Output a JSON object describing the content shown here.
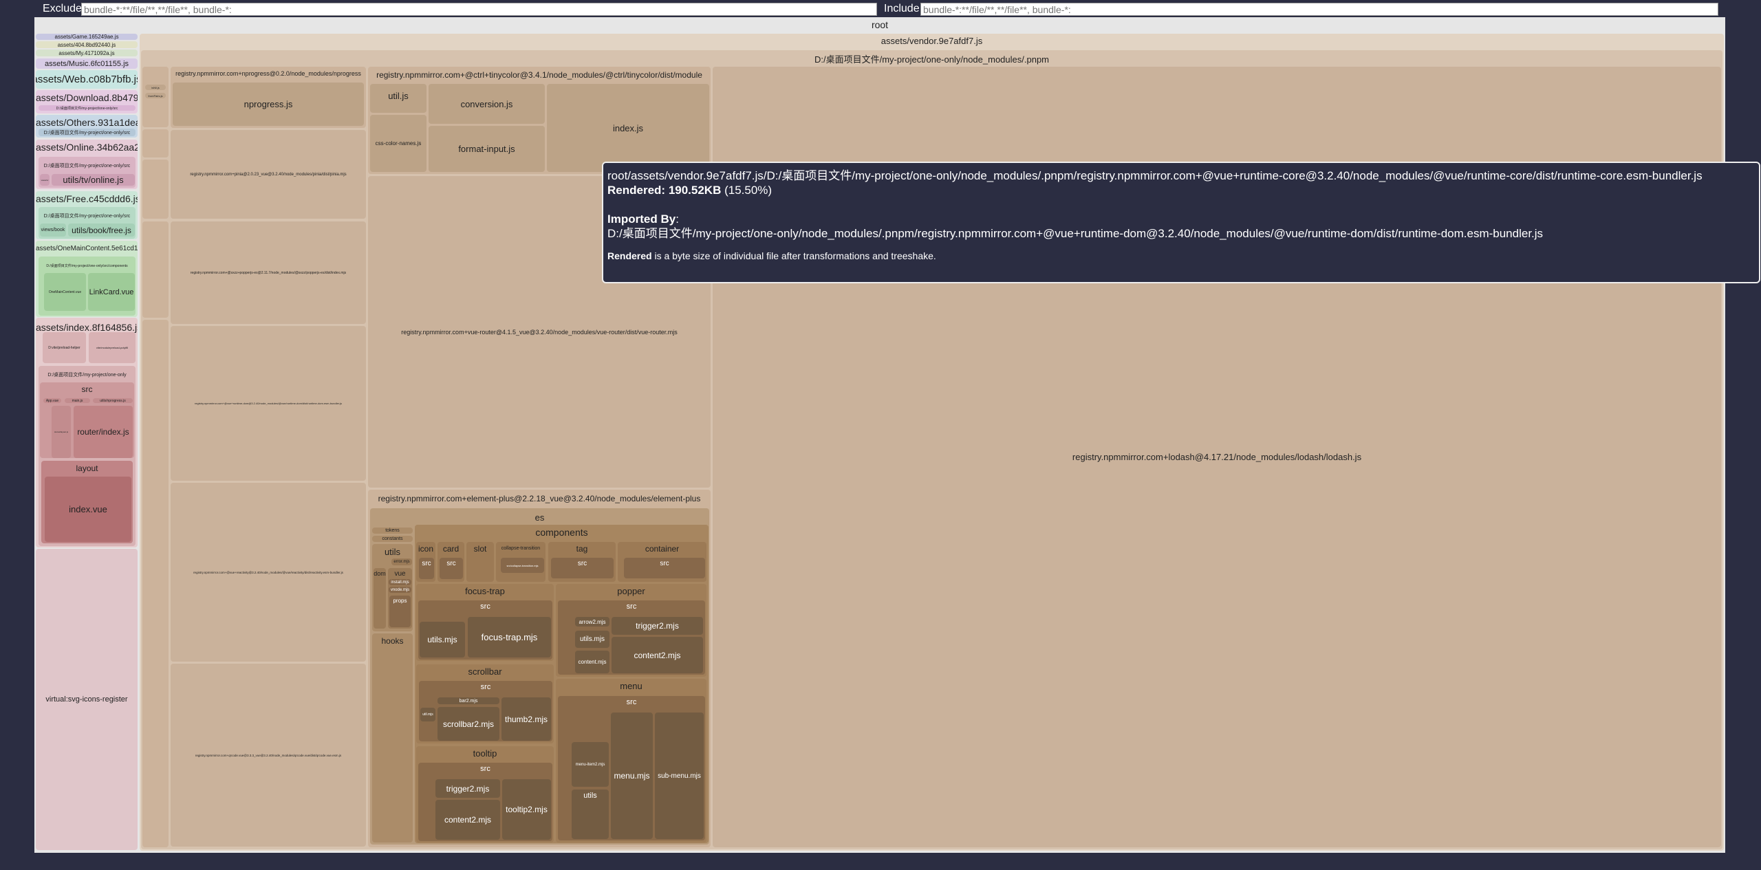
{
  "filters": {
    "exclude_label": "Exclude",
    "exclude_placeholder": "bundle-*:**/file/**,**/file**, bundle-*:",
    "include_label": "Include",
    "include_placeholder": "bundle-*:**/file/**,**/file**, bundle-*:"
  },
  "root": "root",
  "chunks": [
    {
      "label": "assets/Game.165249ae.js",
      "color": "#c8c8e2"
    },
    {
      "label": "assets/404.8bd92440.js",
      "color": "#e2e2c8"
    },
    {
      "label": "assets/My.4171092a.js",
      "color": "#d6e2cc"
    },
    {
      "label": "assets/Music.6fc01155.js",
      "color": "#d8cce6"
    },
    {
      "label": "assets/Web.c08b7bfb.js",
      "color": "#c8e6e2"
    },
    {
      "label": "assets/Download.8b479f4a.js",
      "color": "#e6cce2",
      "inner": "D:/桌面项目文件/my-project/one-only/src"
    },
    {
      "label": "assets/Others.931a1dea.js",
      "color": "#c8d8e6",
      "inner": "D:/桌面项目文件/my-project/one-only/src"
    },
    {
      "label": "assets/Online.34b62aa2.js",
      "color": "#e6ccd8",
      "inner": "D:/桌面项目文件/my-project/one-only/src",
      "small": "views/tv",
      "file": "utils/tv/online.js"
    },
    {
      "label": "assets/Free.c45cddd6.js",
      "color": "#cce6d8",
      "inner": "D:/桌面项目文件/my-project/one-only/src",
      "small": "views/book",
      "file": "utils/book/free.js"
    },
    {
      "label": "assets/OneMainContent.5e61cd1b.js",
      "color": "#cde6cc",
      "inner": "D:/桌面项目文件/my-project/one-only/src/components",
      "files": [
        "OneMainContent.vue",
        "LinkCard.vue"
      ]
    },
    {
      "label": "assets/index.8f164856.js",
      "color": "#e6ccce",
      "files": [
        "D:vite/preload-helper",
        "vite/modulepreload-polyfill"
      ],
      "inner": "D:/桌面项目文件/my-project/one-only",
      "src": "src",
      "src_files": [
        "App.vue",
        "main.js",
        "utils/nprogress.js",
        "stores/layout.js",
        "router/index.js"
      ],
      "layout": "layout",
      "layout_file": "index.vue"
    },
    {
      "label": "virtual:svg-icons-register",
      "color": "#e0c6ca"
    }
  ],
  "vendor": {
    "label": "assets/vendor.9e7afdf7.js",
    "pnpm": "D:/桌面项目文件/my-project/one-only/node_modules/.pnpm",
    "strip_files": [
      "isNil.js",
      "fromPairs.js"
    ],
    "nprogress": {
      "label": "registry.npmmirror.com+nprogress@0.2.0/node_modules/nprogress",
      "file": "nprogress.js"
    },
    "pinia": "registry.npmmirror.com+pinia@2.0.23_vue@3.2.40/node_modules/pinia/dist/pinia.mjs",
    "popper": "registry.npmmirror.com+@sxzz+popperjs-es@2.11.7/node_modules/@sxzz/popperjs-es/dist/index.mjs",
    "runtime_dom": "registry.npmmirror.com+@vue+runtime-dom@3.2.40/node_modules/@vue/runtime-dom/dist/runtime-dom.esm-bundler.js",
    "reactivity": "registry.npmmirror.com+@vue+reactivity@3.2.40/node_modules/@vue/reactivity/dist/reactivity.esm-bundler.js",
    "qrcode": "registry.npmmirror.com+qrcode.vue@3.3.3_vue@3.2.40/node_modules/qrcode.vue/dist/qrcode.vue.esm.js",
    "tinycolor": {
      "label": "registry.npmmirror.com+@ctrl+tinycolor@3.4.1/node_modules/@ctrl/tinycolor/dist/module",
      "files": [
        "util.js",
        "css-color-names.js",
        "conversion.js",
        "format-input.js",
        "index.js"
      ]
    },
    "vue_router": "registry.npmmirror.com+vue-router@4.1.5_vue@3.2.40/node_modules/vue-router/dist/vue-router.mjs",
    "lodash": "registry.npmmirror.com+lodash@4.17.21/node_modules/lodash/lodash.js",
    "element_plus": {
      "label": "registry.npmmirror.com+element-plus@2.2.18_vue@3.2.40/node_modules/element-plus",
      "es": "es",
      "tokens": "tokens",
      "constants": "constants",
      "utils": "utils",
      "dom": "dom",
      "vue": "vue",
      "install": "install.mjs",
      "vnode": "vnode.mjs",
      "props": "props",
      "hooks": "hooks",
      "error": "error.mjs",
      "components": "components",
      "src": "src",
      "icon": "icon",
      "card": "card",
      "slot": "slot",
      "collapse": "collapse-transition",
      "collapse_file": "src/collapse-transition.mjs",
      "tag": "tag",
      "container": "container",
      "focus_trap": "focus-trap",
      "ft_files": [
        "utils.mjs",
        "focus-trap.mjs"
      ],
      "popper": "popper",
      "popper_files": [
        "arrow2.mjs",
        "utils.mjs",
        "content.mjs",
        "trigger2.mjs",
        "content2.mjs"
      ],
      "scrollbar": "scrollbar",
      "sb_files": [
        "bar2.mjs",
        "util.mjs",
        "scrollbar2.mjs",
        "thumb2.mjs"
      ],
      "tooltip": "tooltip",
      "tt_files": [
        "trigger2.mjs",
        "content2.mjs",
        "tooltip2.mjs"
      ],
      "menu": "menu",
      "menu_files": [
        "menu-item2.mjs",
        "menu.mjs",
        "sub-menu.mjs"
      ],
      "menu_utils": "utils"
    }
  },
  "tooltip": {
    "path": "root/assets/vendor.9e7afdf7.js/D:/桌面项目文件/my-project/one-only/node_modules/.pnpm/registry.npmmirror.com+@vue+runtime-core@3.2.40/node_modules/@vue/runtime-core/dist/runtime-core.esm-bundler.js",
    "rendered_label": "Rendered:",
    "rendered_value": "190.52KB",
    "rendered_pct": "(15.50%)",
    "imported_by_label": "Imported By",
    "imported_by_path": "D:/桌面项目文件/my-project/one-only/node_modules/.pnpm/registry.npmmirror.com+@vue+runtime-dom@3.2.40/node_modules/@vue/runtime-dom/dist/runtime-dom.esm-bundler.js",
    "note_bold": "Rendered",
    "note_rest": " is a byte size of individual file after transformations and treeshake."
  }
}
